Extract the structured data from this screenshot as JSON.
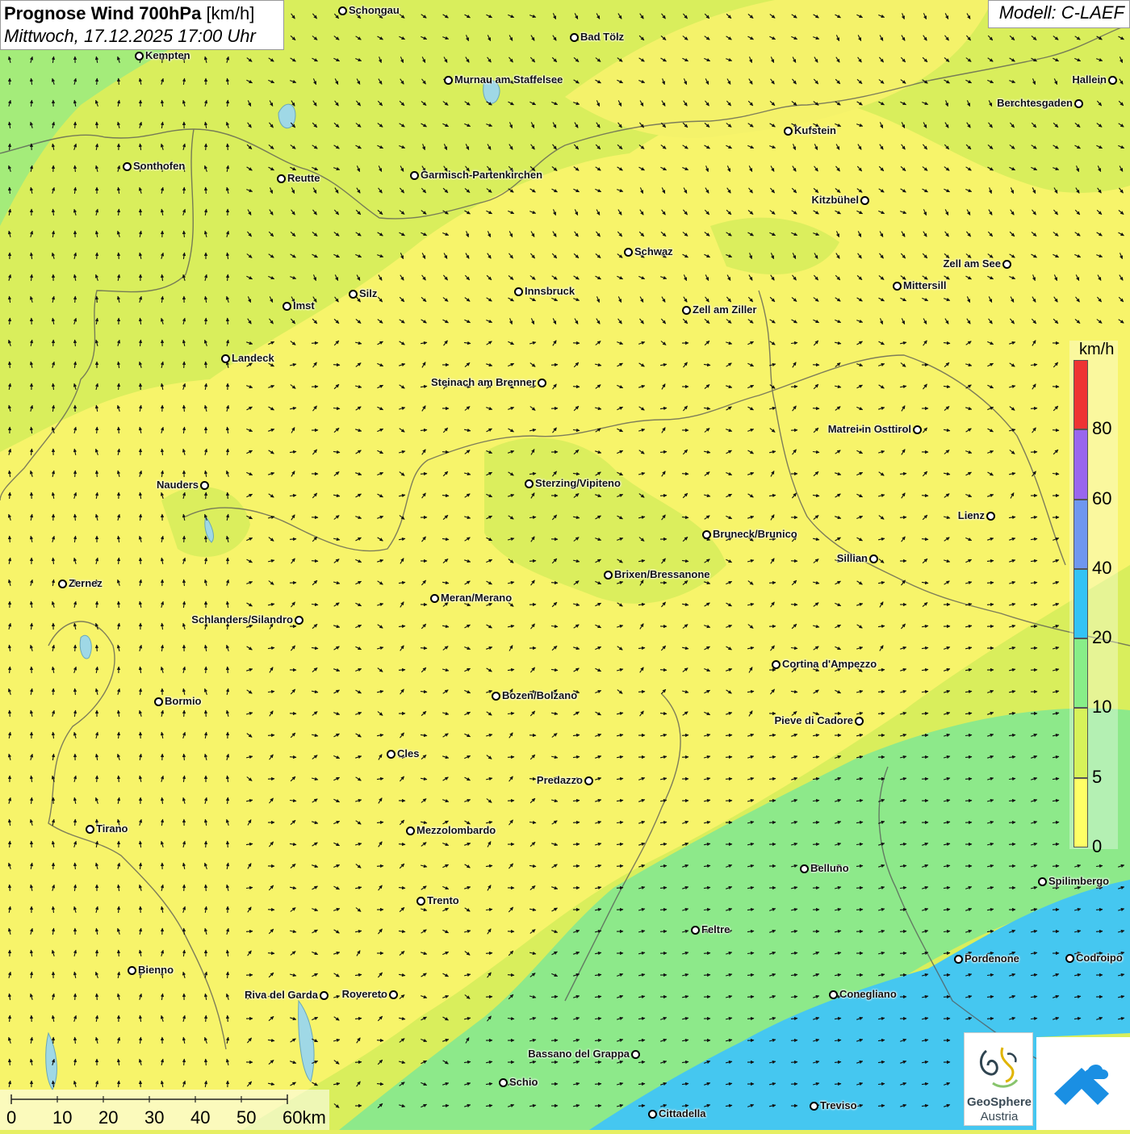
{
  "header": {
    "title_bold": "Prognose Wind 700hPa",
    "title_unit": "[km/h]",
    "datetime": "Mittwoch, 17.12.2025 17:00 Uhr",
    "model": "Modell: C-LAEF"
  },
  "legend": {
    "unit": "km/h",
    "ticks": [
      "0",
      "5",
      "10",
      "20",
      "40",
      "60",
      "80"
    ],
    "colors": [
      "#ffff66",
      "#d7f25a",
      "#88ee88",
      "#33c3f5",
      "#6f97ef",
      "#9966ee",
      "#ee3333"
    ]
  },
  "scale": {
    "labels": [
      "0",
      "10",
      "20",
      "30",
      "40",
      "50",
      "60km"
    ]
  },
  "logos": {
    "geosphere_line1": "GeoSphere",
    "geosphere_line2": "Austria"
  },
  "cities": [
    {
      "name": "Schongau"
    },
    {
      "name": "Bad Tölz"
    },
    {
      "name": "Kempten"
    },
    {
      "name": "Murnau am Staffelsee"
    },
    {
      "name": "Hallein"
    },
    {
      "name": "Berchtesgaden"
    },
    {
      "name": "Kufstein"
    },
    {
      "name": "Sonthofen"
    },
    {
      "name": "Reutte"
    },
    {
      "name": "Garmisch-Partenkirchen"
    },
    {
      "name": "Kitzbühel"
    },
    {
      "name": "Schwaz"
    },
    {
      "name": "Zell am See"
    },
    {
      "name": "Mittersill"
    },
    {
      "name": "Innsbruck"
    },
    {
      "name": "Silz"
    },
    {
      "name": "Imst"
    },
    {
      "name": "Zell am Ziller"
    },
    {
      "name": "Landeck"
    },
    {
      "name": "Steinach am Brenner"
    },
    {
      "name": "Matrei in Osttirol"
    },
    {
      "name": "Nauders"
    },
    {
      "name": "Sterzing/Vipiteno"
    },
    {
      "name": "Lienz"
    },
    {
      "name": "Bruneck/Brunico"
    },
    {
      "name": "Sillian"
    },
    {
      "name": "Brixen/Bressanone"
    },
    {
      "name": "Zernez"
    },
    {
      "name": "Meran/Merano"
    },
    {
      "name": "Schlanders/Silandro"
    },
    {
      "name": "Cortina d'Ampezzo"
    },
    {
      "name": "Bozen/Bolzano"
    },
    {
      "name": "Bormio"
    },
    {
      "name": "Pieve di Cadore"
    },
    {
      "name": "Cles"
    },
    {
      "name": "Predazzo"
    },
    {
      "name": "Tirano"
    },
    {
      "name": "Mezzolombardo"
    },
    {
      "name": "Belluno"
    },
    {
      "name": "Spilimbergo"
    },
    {
      "name": "Trento"
    },
    {
      "name": "Feltre"
    },
    {
      "name": "Bienno"
    },
    {
      "name": "Pordenone"
    },
    {
      "name": "Codroipo"
    },
    {
      "name": "Riva del Garda"
    },
    {
      "name": "Rovereto"
    },
    {
      "name": "Conegliano"
    },
    {
      "name": "Bassano del Grappa"
    },
    {
      "name": "Schio"
    },
    {
      "name": "Treviso"
    },
    {
      "name": "Cittadella"
    }
  ]
}
